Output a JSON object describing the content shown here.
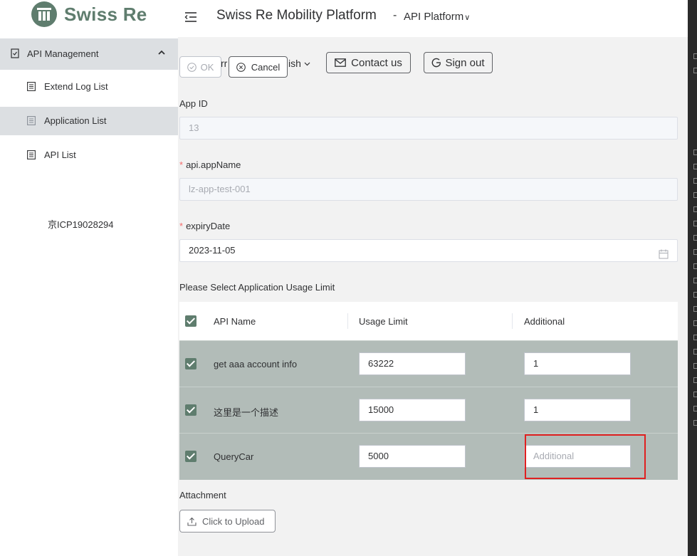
{
  "header": {
    "logo_text": "Swiss Re",
    "title": "Swiss Re Mobility Platform",
    "separator": "-",
    "platform_selector": "API Platform",
    "platform_caret": "∨"
  },
  "sidebar": {
    "group_label": "API Management",
    "items": [
      {
        "label": "Extend Log List",
        "active": false
      },
      {
        "label": "Application List",
        "active": true
      },
      {
        "label": "API List",
        "active": false
      }
    ],
    "icp": "京ICP19028294"
  },
  "toolbar": {
    "ok_label": "OK",
    "cancel_label": "Cancel",
    "language_fragment_left": "rr",
    "language_fragment_right": "ish",
    "contact_label": "Contact us",
    "signout_label": "Sign out"
  },
  "form": {
    "app_id_label": "App ID",
    "app_id_value": "13",
    "app_name_label": "api.appName",
    "app_name_value": "lz-app-test-001",
    "expiry_label": "expiryDate",
    "expiry_value": "2023-11-05",
    "required_mark": "*",
    "usage_section_label": "Please Select Application Usage Limit",
    "attachment_label": "Attachment",
    "upload_label": "Click to Upload"
  },
  "usage_table": {
    "columns": [
      "API Name",
      "Usage Limit",
      "Additional"
    ],
    "rows": [
      {
        "api_name": "get aaa account info",
        "usage_limit": "63222",
        "additional": "1",
        "checked": true
      },
      {
        "api_name": "这里是一个描述",
        "usage_limit": "15000",
        "additional": "1",
        "checked": true
      },
      {
        "api_name": "QueryCar",
        "usage_limit": "5000",
        "additional": "",
        "checked": true
      }
    ],
    "additional_placeholder": "Additional"
  },
  "colors": {
    "brand": "#5f7d6e",
    "row_bg": "#b2bcb8",
    "highlight": "#e02020"
  }
}
